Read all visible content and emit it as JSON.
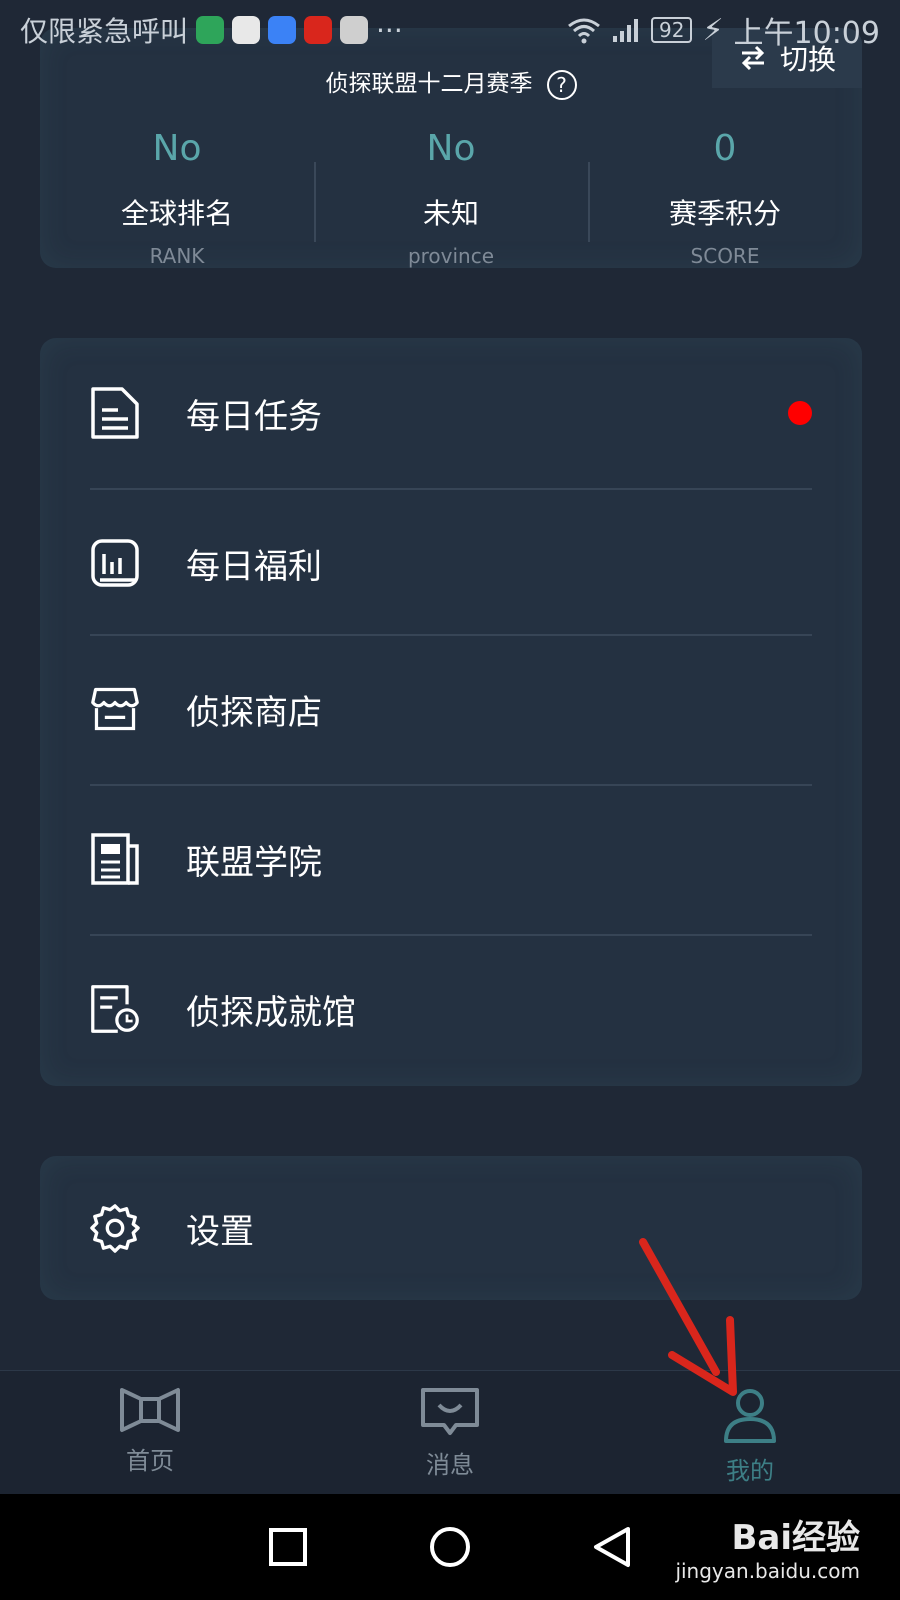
{
  "status_bar": {
    "carrier": "仅限紧急呼叫",
    "more": "···",
    "battery": "92",
    "time": "上午10:09"
  },
  "stats": {
    "title": "侦探联盟十二月赛季",
    "help": "?",
    "switch_label": "切换",
    "items": [
      {
        "value": "No",
        "label": "全球排名",
        "sub": "RANK"
      },
      {
        "value": "No",
        "label": "未知",
        "sub": "province"
      },
      {
        "value": "0",
        "label": "赛季积分",
        "sub": "SCORE"
      }
    ]
  },
  "menu": {
    "items": [
      {
        "label": "每日任务",
        "icon": "document-icon",
        "badge": true
      },
      {
        "label": "每日福利",
        "icon": "chart-icon",
        "badge": false
      },
      {
        "label": "侦探商店",
        "icon": "store-icon",
        "badge": false
      },
      {
        "label": "联盟学院",
        "icon": "newspaper-icon",
        "badge": false
      },
      {
        "label": "侦探成就馆",
        "icon": "clock-doc-icon",
        "badge": false
      }
    ]
  },
  "settings": {
    "label": "设置",
    "icon": "gear-icon"
  },
  "bottom_nav": {
    "items": [
      {
        "label": "首页",
        "icon": "bowtie-icon",
        "active": false
      },
      {
        "label": "消息",
        "icon": "message-icon",
        "active": false
      },
      {
        "label": "我的",
        "icon": "person-icon",
        "active": true
      }
    ]
  },
  "watermark": {
    "brand": "Bai经验",
    "url": "jingyan.baidu.com"
  },
  "colors": {
    "background": "#1f2836",
    "card": "#243141",
    "accent": "#5aa6aa",
    "active_nav": "#3d7f86",
    "badge": "#ff0000",
    "annotation_arrow": "#d9261c"
  }
}
